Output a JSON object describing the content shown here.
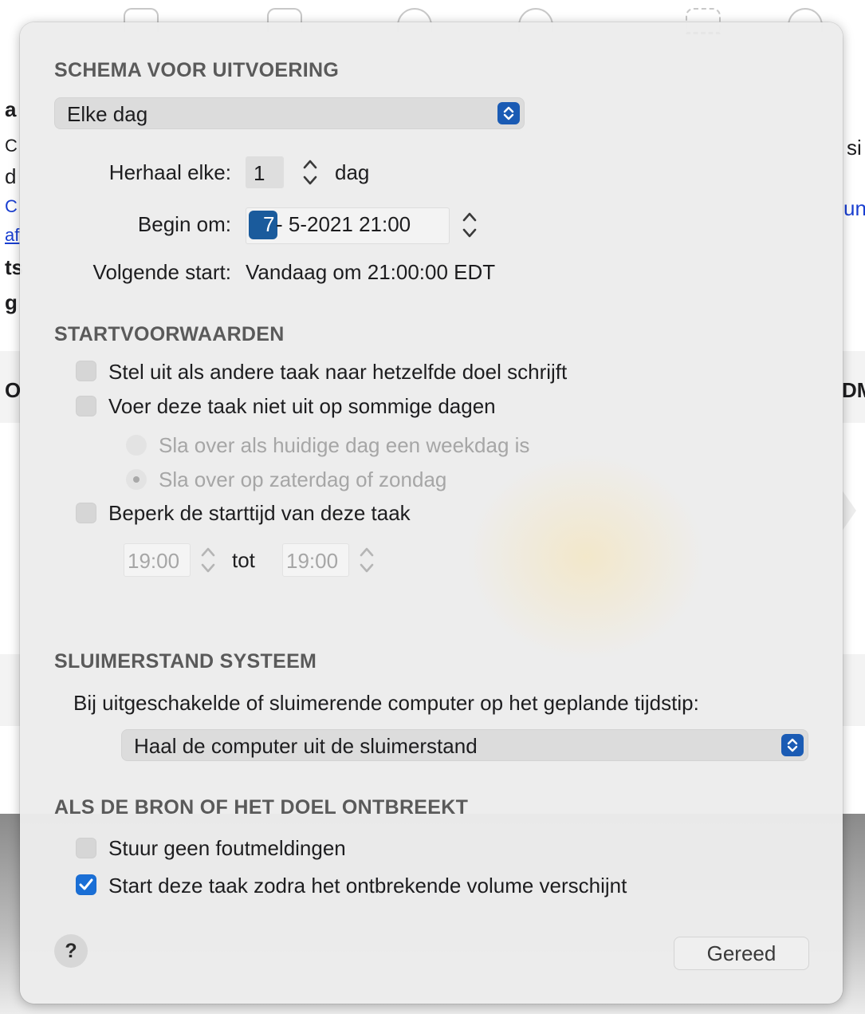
{
  "background": {
    "left_fragments": [
      "a",
      "C",
      "d",
      "C",
      "af",
      "ts",
      "g",
      "O"
    ],
    "right_fragments": [
      "si",
      "un",
      "DM"
    ]
  },
  "schedule": {
    "title": "SCHEMA VOOR UITVOERING",
    "frequency_value": "Elke dag",
    "repeat_label": "Herhaal elke:",
    "repeat_value": "1",
    "repeat_unit": "dag",
    "begin_label": "Begin om:",
    "begin_day": "7",
    "begin_rest": "- 5-2021 21:00",
    "next_label": "Volgende start:",
    "next_value": "Vandaag om 21:00:00 EDT"
  },
  "conditions": {
    "title": "STARTVOORWAARDEN",
    "postpone_label": "Stel uit als andere taak naar hetzelfde doel schrijft",
    "skip_days_label": "Voer deze taak niet uit op sommige dagen",
    "skip_weekday_label": "Sla over als huidige dag een weekdag is",
    "skip_weekend_label": "Sla over op zaterdag of zondag",
    "limit_label": "Beperk de starttijd van deze taak",
    "time_from": "19:00",
    "time_to_label": "tot",
    "time_to": "19:00"
  },
  "sleep": {
    "title": "SLUIMERSTAND SYSTEEM",
    "description": "Bij uitgeschakelde of sluimerende computer op het geplande tijdstip:",
    "action_value": "Haal de computer uit de sluimerstand"
  },
  "missing": {
    "title": "ALS DE BRON OF HET DOEL ONTBREEKT",
    "no_errors_label": "Stuur geen foutmeldingen",
    "start_on_volume_label": "Start deze taak zodra het ontbrekende volume verschijnt"
  },
  "footer": {
    "help_label": "?",
    "done_label": "Gereed"
  },
  "colors": {
    "accent": "#1a6fd6",
    "popover_bg": "#ececec",
    "section_title": "#5a5a5a"
  }
}
